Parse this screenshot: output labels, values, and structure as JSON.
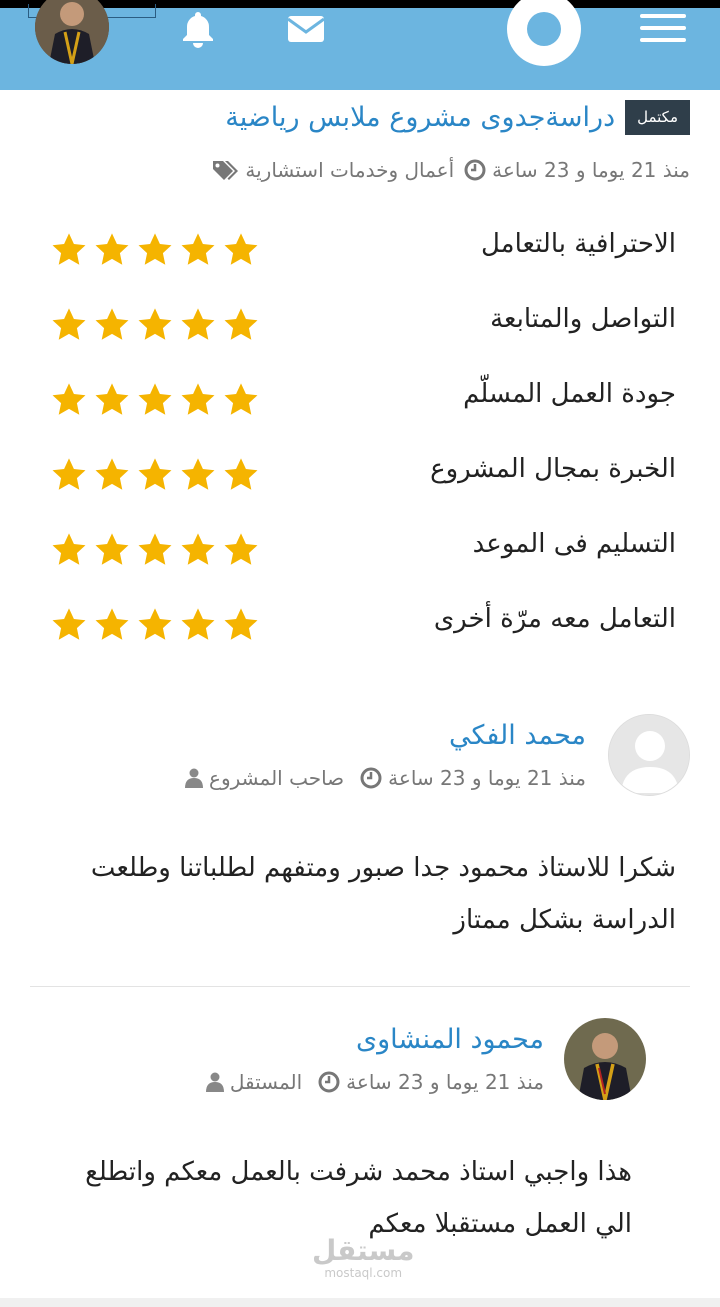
{
  "topbar": {
    "bg_color": "#6cb5e0",
    "icons": [
      "avatar",
      "bell-icon",
      "envelope-icon",
      "profile-circle-icon",
      "hamburger-menu-icon"
    ]
  },
  "project": {
    "status_badge": "مكتمل",
    "title": "دراسةجدوى مشروع ملابس رياضية",
    "category": "أعمال وخدمات استشارية",
    "time_ago": "منذ 21 يوما و 23 ساعة"
  },
  "ratings": [
    {
      "label": "الاحترافية بالتعامل",
      "stars": 5
    },
    {
      "label": "التواصل والمتابعة",
      "stars": 5
    },
    {
      "label": "جودة العمل المسلّم",
      "stars": 5
    },
    {
      "label": "الخبرة بمجال المشروع",
      "stars": 5
    },
    {
      "label": "التسليم فى الموعد",
      "stars": 5
    },
    {
      "label": "التعامل معه مرّة أخرى",
      "stars": 5
    }
  ],
  "star_color": "#f5b400",
  "comments": [
    {
      "name": "محمد الفكي",
      "role": "صاحب المشروع",
      "time_ago": "منذ 21 يوما و 23 ساعة",
      "body": "شكرا للاستاذ محمود جدا صبور ومتفهم لطلباتنا وطلعت الدراسة بشكل ممتاز"
    },
    {
      "name": "محمود المنشاوى",
      "role": "المستقل",
      "time_ago": "منذ 21 يوما و 23 ساعة",
      "body": "هذا واجبي استاذ محمد شرفت بالعمل معكم واتطلع الي العمل مستقبلا معكم"
    }
  ],
  "watermark": {
    "arabic": "مستقل",
    "latin": "mostaql.com"
  }
}
